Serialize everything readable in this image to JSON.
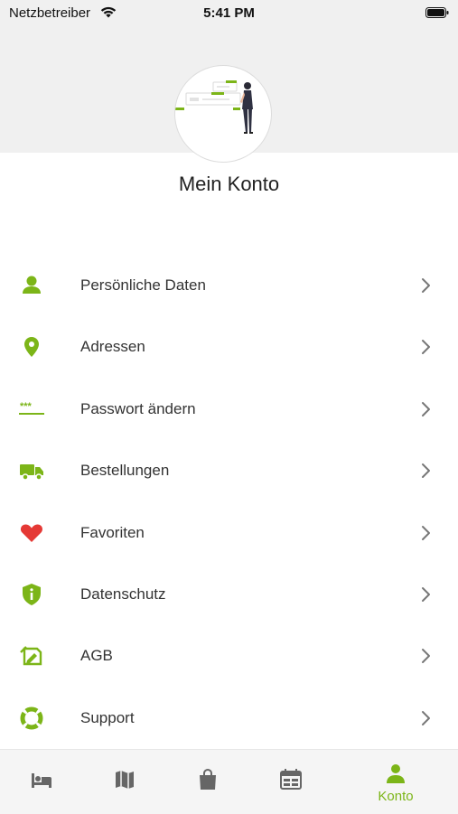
{
  "status_bar": {
    "carrier": "Netzbetreiber",
    "time": "5:41 PM"
  },
  "page": {
    "title": "Mein Konto"
  },
  "accent_color": "#7cb518",
  "menu": {
    "items": [
      {
        "label": "Persönliche Daten",
        "icon": "person-icon"
      },
      {
        "label": "Adressen",
        "icon": "location-pin-icon"
      },
      {
        "label": "Passwort ändern",
        "icon": "password-icon"
      },
      {
        "label": "Bestellungen",
        "icon": "truck-icon"
      },
      {
        "label": "Favoriten",
        "icon": "heart-icon"
      },
      {
        "label": "Datenschutz",
        "icon": "shield-info-icon"
      },
      {
        "label": "AGB",
        "icon": "document-icon"
      },
      {
        "label": "Support",
        "icon": "lifebuoy-icon"
      }
    ]
  },
  "tab_bar": {
    "tabs": [
      {
        "icon": "bed-icon"
      },
      {
        "icon": "map-icon"
      },
      {
        "icon": "shopping-bag-icon"
      },
      {
        "icon": "calendar-icon"
      },
      {
        "icon": "account-icon",
        "label": "Konto",
        "active": true
      }
    ]
  }
}
